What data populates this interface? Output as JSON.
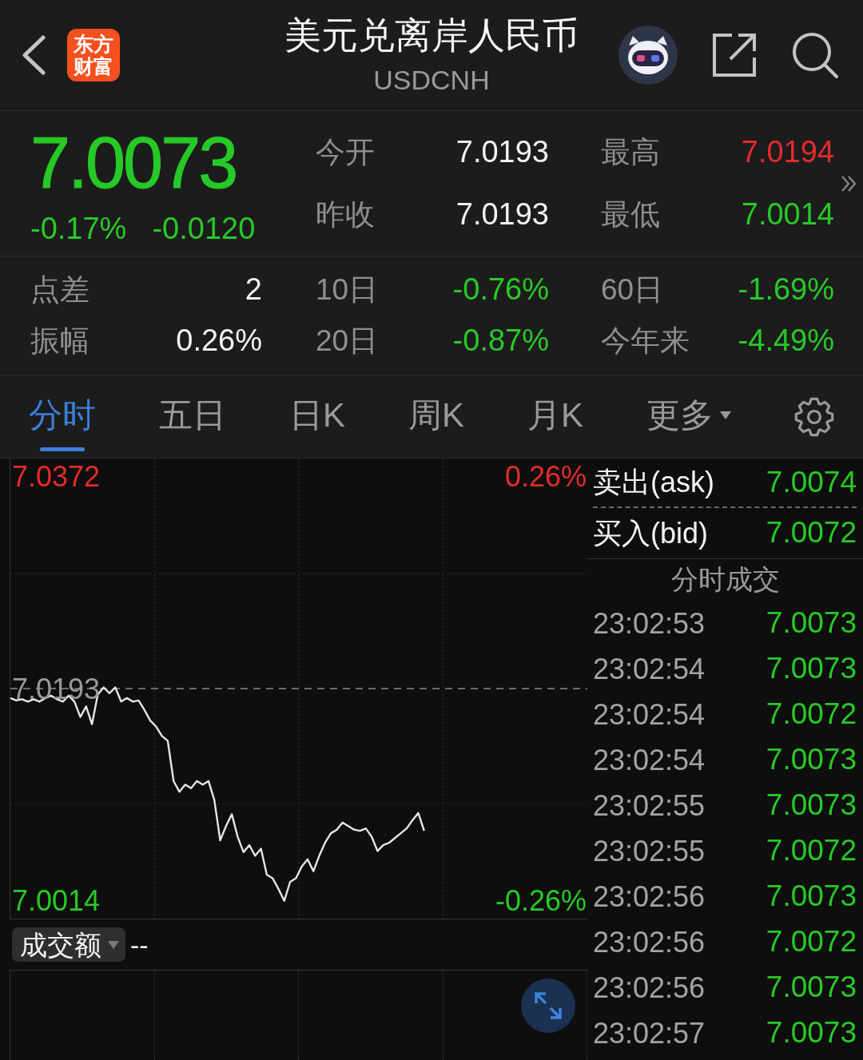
{
  "header": {
    "title": "美元兑离岸人民币",
    "subtitle": "USDCNH",
    "logo_lines": [
      "东方",
      "财富"
    ]
  },
  "quote": {
    "price": "7.0073",
    "change_percent": "-0.17%",
    "change": "-0.0120",
    "stats": [
      [
        {
          "label": "今开",
          "value": "7.0193",
          "color": "#f2f2f2"
        },
        {
          "label": "最高",
          "value": "7.0194",
          "color": "#e42a2a"
        }
      ],
      [
        {
          "label": "昨收",
          "value": "7.0193",
          "color": "#f2f2f2"
        },
        {
          "label": "最低",
          "value": "7.0014",
          "color": "#27c927"
        }
      ]
    ]
  },
  "performance": [
    [
      {
        "label": "点差",
        "value": "2",
        "color": "#f2f2f2"
      },
      {
        "label": "10日",
        "value": "-0.76%",
        "color": "#27c927"
      },
      {
        "label": "60日",
        "value": "-1.69%",
        "color": "#27c927"
      }
    ],
    [
      {
        "label": "振幅",
        "value": "0.26%",
        "color": "#f2f2f2"
      },
      {
        "label": "20日",
        "value": "-0.87%",
        "color": "#27c927"
      },
      {
        "label": "今年来",
        "value": "-4.49%",
        "color": "#27c927"
      }
    ]
  ],
  "tabs": [
    {
      "label": "分时",
      "kind": "tab",
      "selected": true
    },
    {
      "label": "五日",
      "kind": "tab",
      "selected": false
    },
    {
      "label": "日K",
      "kind": "tab",
      "selected": false
    },
    {
      "label": "周K",
      "kind": "tab",
      "selected": false
    },
    {
      "label": "月K",
      "kind": "tab",
      "selected": false
    },
    {
      "label": "更多",
      "kind": "dropdown",
      "selected": false
    }
  ],
  "chart": {
    "chart_data": {
      "type": "line",
      "values": [
        7.0185,
        7.0183,
        7.0184,
        7.0182,
        7.0184,
        7.0182,
        7.0185,
        7.0187,
        7.0184,
        7.0182,
        7.0187,
        7.0182,
        7.0169,
        7.0178,
        7.0163,
        7.0188,
        7.0194,
        7.0189,
        7.0194,
        7.0182,
        7.0185,
        7.0182,
        7.0183,
        7.0175,
        7.0166,
        7.0161,
        7.0153,
        7.0149,
        7.0115,
        7.0106,
        7.0112,
        7.0109,
        7.0115,
        7.0112,
        7.0115,
        7.0099,
        7.0065,
        7.0077,
        7.0087,
        7.0068,
        7.0055,
        7.0061,
        7.0052,
        7.0058,
        7.0036,
        7.0033,
        7.0024,
        7.0014,
        7.003,
        7.0033,
        7.0043,
        7.0049,
        7.0039,
        7.0052,
        7.0063,
        7.0071,
        7.0074,
        7.008,
        7.0077,
        7.0074,
        7.0073,
        7.0075,
        7.0068,
        7.0056,
        7.0061,
        7.0063,
        7.0067,
        7.0071,
        7.0075,
        7.0082,
        7.0088,
        7.0073,
        null,
        null,
        null,
        null,
        null,
        null,
        null,
        null,
        null,
        null,
        null,
        null,
        null,
        null,
        null,
        null,
        null,
        null,
        null,
        null,
        null,
        null,
        null,
        null,
        null,
        null,
        null,
        null
      ],
      "ylim": [
        6.9999,
        7.0387
      ],
      "yticks": [
        {
          "value": 7.0372,
          "label": "7.0372"
        },
        {
          "value": 7.0193,
          "label": "7.0193"
        },
        {
          "value": 7.0014,
          "label": "7.0014"
        }
      ],
      "ref_lines": [
        {
          "axis": "y",
          "value": 7.0193
        }
      ]
    },
    "percent_labels": [
      "0.26%",
      "-0.26%"
    ]
  },
  "volume": {
    "selector": "成交额",
    "value": "--"
  },
  "order_book": {
    "ask": {
      "label": "卖出(ask)",
      "value": "7.0074"
    },
    "bid": {
      "label": "买入(bid)",
      "value": "7.0072"
    }
  },
  "trades": {
    "title": "分时成交",
    "rows": [
      {
        "time": "23:02:53",
        "price": "7.0073"
      },
      {
        "time": "23:02:54",
        "price": "7.0073"
      },
      {
        "time": "23:02:54",
        "price": "7.0072"
      },
      {
        "time": "23:02:54",
        "price": "7.0073"
      },
      {
        "time": "23:02:55",
        "price": "7.0073"
      },
      {
        "time": "23:02:55",
        "price": "7.0072"
      },
      {
        "time": "23:02:56",
        "price": "7.0073"
      },
      {
        "time": "23:02:56",
        "price": "7.0072"
      },
      {
        "time": "23:02:56",
        "price": "7.0073"
      },
      {
        "time": "23:02:57",
        "price": "7.0073"
      }
    ]
  }
}
